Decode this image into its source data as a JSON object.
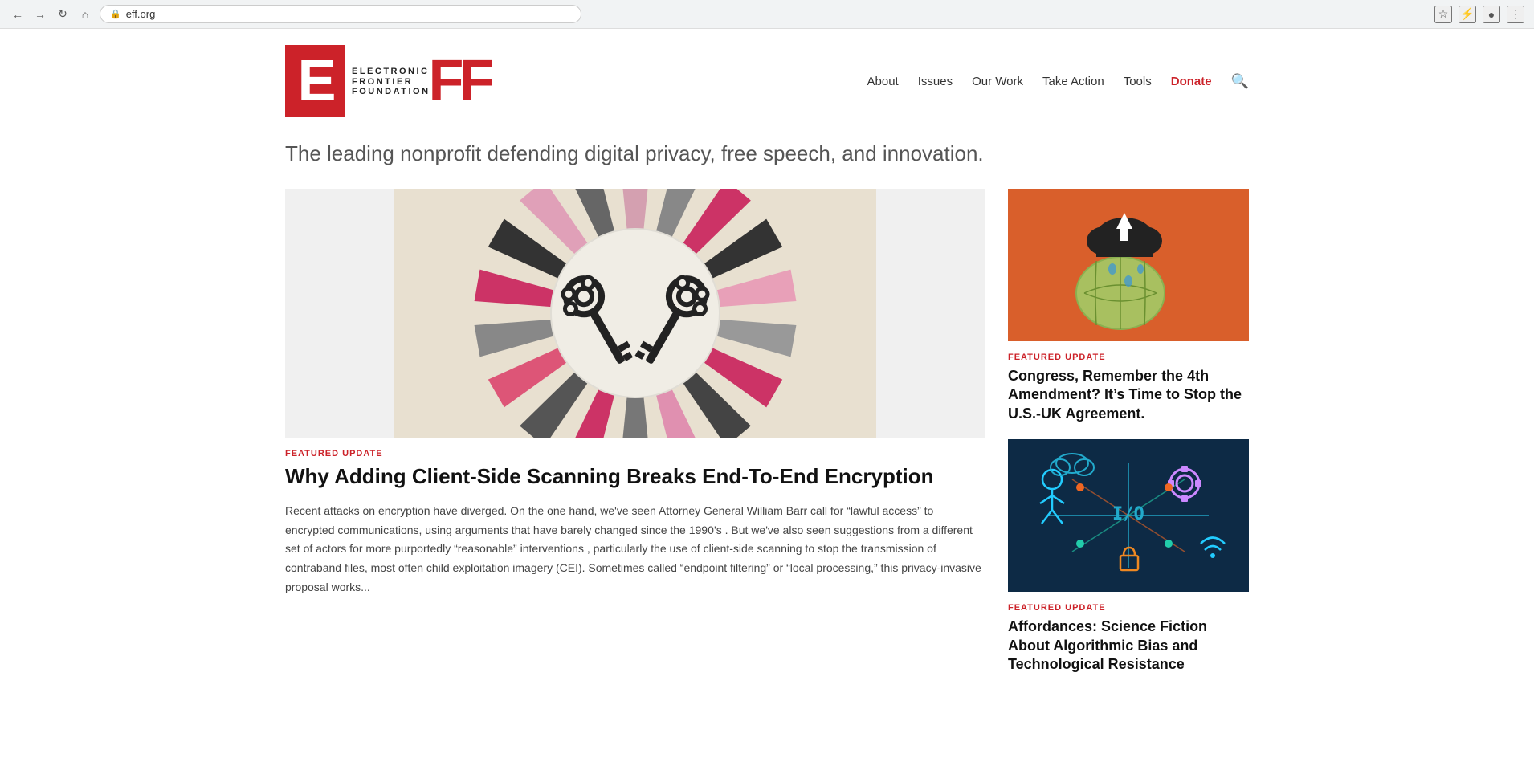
{
  "browser": {
    "url": "eff.org",
    "back_title": "Back",
    "forward_title": "Forward",
    "reload_title": "Reload",
    "home_title": "Home"
  },
  "header": {
    "logo_org_line1": "ELECTRONIC",
    "logo_org_line2": "FRONTIER",
    "logo_org_line3": "FOUNDATION",
    "logo_e": "E",
    "logo_ff": "FF",
    "nav": {
      "about": "About",
      "issues": "Issues",
      "our_work": "Our Work",
      "take_action": "Take Action",
      "tools": "Tools",
      "donate": "Donate"
    }
  },
  "tagline": "The leading nonprofit defending digital privacy, free speech, and innovation.",
  "featured_main": {
    "tag": "FEATURED UPDATE",
    "title": "Why Adding Client-Side Scanning Breaks End-To-End Encryption",
    "excerpt": "Recent attacks on encryption have diverged. On the one hand, we've seen Attorney General William Barr call for “lawful access” to encrypted communications, using arguments that have barely changed since the 1990’s . But we've also seen suggestions from a different set of actors for more purportedly “reasonable” interventions , particularly the use of client-side scanning to stop the transmission of contraband files, most often child exploitation imagery (CEI). Sometimes called “endpoint filtering” or “local processing,” this privacy-invasive proposal works..."
  },
  "side_articles": [
    {
      "tag": "FEATURED UPDATE",
      "title": "Congress, Remember the 4th Amendment? It’s Time to Stop the U.S.-UK Agreement.",
      "image_type": "congress"
    },
    {
      "tag": "FEATURED UPDATE",
      "title": "Affordances: Science Fiction About Algorithmic Bias and Technological Resistance",
      "image_type": "algorithmic"
    }
  ]
}
